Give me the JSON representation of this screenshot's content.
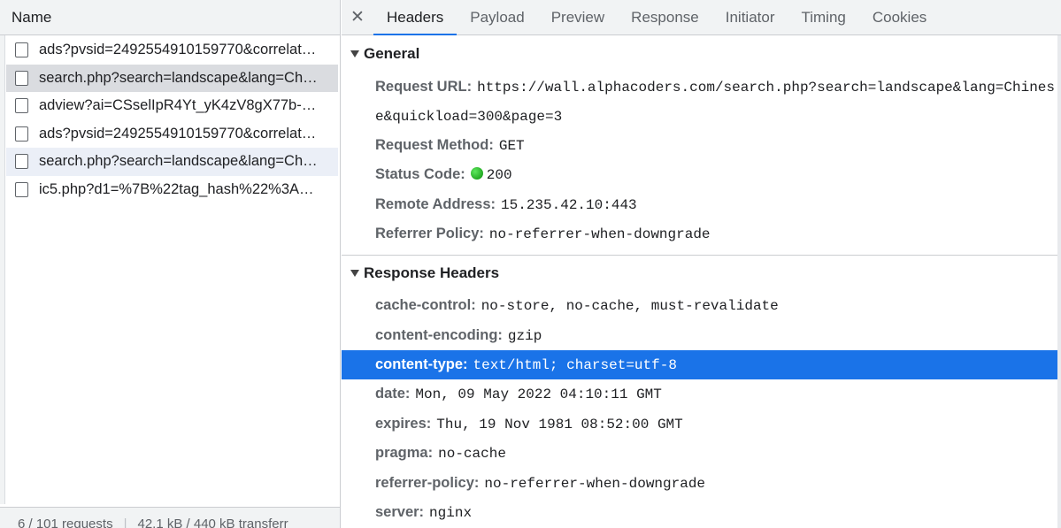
{
  "left": {
    "column_header": "Name",
    "requests": [
      {
        "name": "ads?pvsid=2492554910159770&correlat…",
        "state": "normal"
      },
      {
        "name": "search.php?search=landscape&lang=Ch…",
        "state": "selected"
      },
      {
        "name": "adview?ai=CSselIpR4Yt_yK4zV8gX77b-…",
        "state": "normal"
      },
      {
        "name": "ads?pvsid=2492554910159770&correlat…",
        "state": "normal"
      },
      {
        "name": "search.php?search=landscape&lang=Ch…",
        "state": "hover"
      },
      {
        "name": "ic5.php?d1=%7B%22tag_hash%22%3A…",
        "state": "normal"
      }
    ],
    "footer": {
      "requests": "6 / 101 requests",
      "transferred": "42.1 kB / 440 kB transferr"
    }
  },
  "tabs": {
    "close": "✕",
    "items": [
      "Headers",
      "Payload",
      "Preview",
      "Response",
      "Initiator",
      "Timing",
      "Cookies"
    ],
    "active": "Headers"
  },
  "general": {
    "title": "General",
    "request_url_label": "Request URL:",
    "request_url": "https://wall.alphacoders.com/search.php?search=landscape&lang=Chinese&quickload=300&page=3",
    "request_method_label": "Request Method:",
    "request_method": "GET",
    "status_code_label": "Status Code:",
    "status_code": "200",
    "remote_address_label": "Remote Address:",
    "remote_address": "15.235.42.10:443",
    "referrer_policy_label": "Referrer Policy:",
    "referrer_policy": "no-referrer-when-downgrade"
  },
  "response_headers": {
    "title": "Response Headers",
    "rows": [
      {
        "key": "cache-control:",
        "value": "no-store, no-cache, must-revalidate"
      },
      {
        "key": "content-encoding:",
        "value": "gzip"
      },
      {
        "key": "content-type:",
        "value": "text/html; charset=utf-8"
      },
      {
        "key": "date:",
        "value": "Mon, 09 May 2022 04:10:11 GMT"
      },
      {
        "key": "expires:",
        "value": "Thu, 19 Nov 1981 08:52:00 GMT"
      },
      {
        "key": "pragma:",
        "value": "no-cache"
      },
      {
        "key": "referrer-policy:",
        "value": "no-referrer-when-downgrade"
      },
      {
        "key": "server:",
        "value": "nginx"
      }
    ],
    "highlighted_row": 2
  },
  "colors": {
    "accent": "#1a73e8",
    "status_ok": "#1e9e1e"
  }
}
